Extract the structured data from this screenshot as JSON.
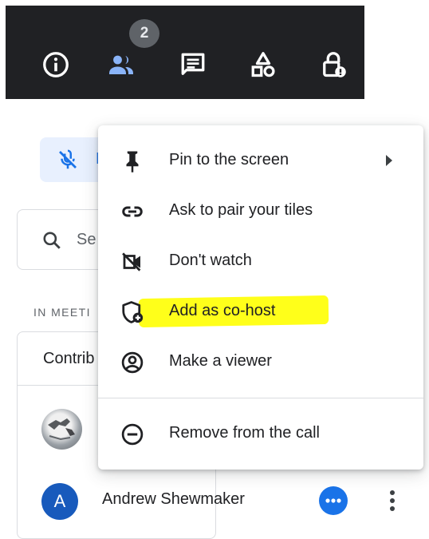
{
  "toolbar": {
    "people_count": "2",
    "icons": [
      "info-icon",
      "people-icon",
      "chat-icon",
      "activities-icon",
      "host-controls-icon"
    ]
  },
  "background": {
    "mute_button_text": "N",
    "search_placeholder": "Se",
    "section_label": "IN MEETI",
    "contributors_title": "Contrib",
    "participant": {
      "avatar_letter": "A",
      "name": "Andrew Shewmaker"
    }
  },
  "menu": {
    "items": [
      {
        "label": "Pin to the screen",
        "icon": "pin-icon",
        "has_submenu": true
      },
      {
        "label": "Ask to pair your tiles",
        "icon": "link-icon"
      },
      {
        "label": "Don't watch",
        "icon": "videocam-off-icon"
      },
      {
        "label": "Add as co-host",
        "icon": "add-cohost-icon",
        "highlighted": true
      },
      {
        "label": "Make a viewer",
        "icon": "account-circle-icon"
      },
      {
        "label": "Remove from the call",
        "icon": "remove-circle-icon"
      }
    ]
  },
  "colors": {
    "toolbar_bg": "#202124",
    "accent_blue": "#1a73e8",
    "highlight_yellow": "#ffff1a",
    "avatar_blue": "#185abc"
  }
}
